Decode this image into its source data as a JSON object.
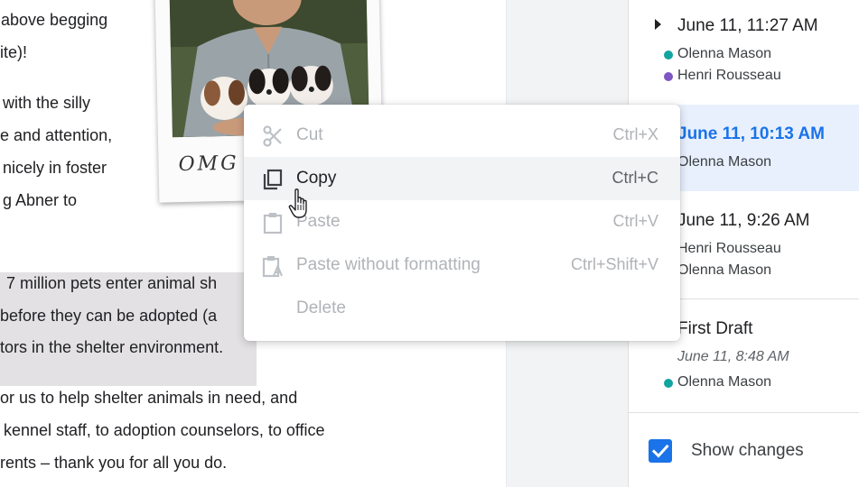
{
  "document": {
    "lines": [
      "above begging",
      "ite)!",
      "with the silly",
      "e and attention,",
      "nicely in foster",
      "g Abner to",
      "7 million pets enter animal sh",
      "before they can be adopted (a",
      "tors in the shelter environment.",
      "or us to help shelter animals in need, and",
      "kennel staff, to adoption counselors, to office",
      "rents – thank you for all you do."
    ],
    "photo_caption": "OMG"
  },
  "context_menu": {
    "items": [
      {
        "label": "Cut",
        "shortcut": "Ctrl+X",
        "icon": "scissors-icon",
        "enabled": false
      },
      {
        "label": "Copy",
        "shortcut": "Ctrl+C",
        "icon": "copy-icon",
        "enabled": true
      },
      {
        "label": "Paste",
        "shortcut": "Ctrl+V",
        "icon": "clipboard-icon",
        "enabled": false
      },
      {
        "label": "Paste without formatting",
        "shortcut": "Ctrl+Shift+V",
        "icon": "clipboard-text-icon",
        "enabled": false
      },
      {
        "label": "Delete",
        "shortcut": "",
        "icon": "",
        "enabled": false
      }
    ]
  },
  "version_history": {
    "versions": [
      {
        "title": "June 11, 11:27 AM",
        "authors": [
          "Olenna Mason",
          "Henri Rousseau"
        ]
      },
      {
        "title": "June 11, 10:13 AM",
        "authors": [
          "Olenna Mason"
        ]
      },
      {
        "title": "June 11, 9:26 AM",
        "authors": [
          "Henri Rousseau",
          "Olenna Mason"
        ]
      },
      {
        "title": "First Draft",
        "subtitle": "June 11, 8:48 AM",
        "authors": [
          "Olenna Mason"
        ]
      }
    ],
    "author_colors": {
      "Olenna Mason": "#12a4a0",
      "Henri Rousseau": "#7e57c2"
    },
    "show_changes_label": "Show changes",
    "show_changes_checked": true
  },
  "colors": {
    "accent": "#1a73e8",
    "selected_bg": "#e8f0fe",
    "highlight_bg": "#e3e1e3"
  }
}
